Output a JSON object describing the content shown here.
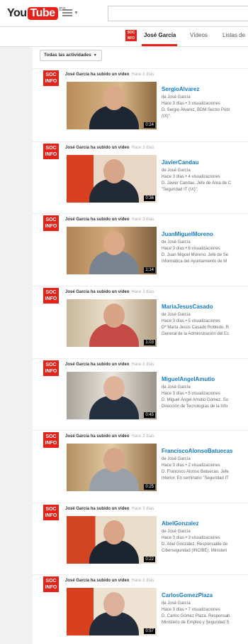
{
  "header": {
    "logo_you": "You",
    "logo_tube": "Tube",
    "logo_region": "ES"
  },
  "channel": {
    "avatar_text": "SOC NFO",
    "tabs": [
      "José García",
      "Vídeos",
      "Listas de"
    ]
  },
  "filter": {
    "label": "Todas las actividades"
  },
  "activity_label": "José García ha subido un vídeo",
  "ago_label": "Hace 3 días",
  "avatar_text": "SOC INFO",
  "items": [
    {
      "title": "SergioAlvarez",
      "by": "de José García",
      "meta": "Hace 3 días • 3 visualizaciones",
      "desc1": "D. Sergio Álvarez, BDM Sector Públ",
      "desc2": "(IX)\".",
      "duration": "0:24"
    },
    {
      "title": "JavierCandau",
      "by": "de José García",
      "meta": "Hace 3 días • 4 visualizaciones",
      "desc1": "D. Javier Candau. Jefe de Área de C",
      "desc2": "\"Seguridad IT (IX)\".",
      "duration": "0:36"
    },
    {
      "title": "JuanMiguelMoreno",
      "by": "de José García",
      "meta": "Hace 3 días • 6 visualizaciones",
      "desc1": "D. Juan Miguel Moreno. Jefe de Se",
      "desc2": "Informática del Ayuntamiento de M",
      "duration": "1:14"
    },
    {
      "title": "MariaJesusCasado",
      "by": "de José García",
      "meta": "Hace 3 días • 5 visualizaciones",
      "desc1": "Dª María Jesús Casado Robledo. R",
      "desc2": "General de la Administración del Es",
      "duration": "1:03"
    },
    {
      "title": "MiguelAngelAmutio",
      "by": "de José García",
      "meta": "Hace 3 días • 5 visualizaciones",
      "desc1": "D. Miguel Ángel Amutio Gómez. Su",
      "desc2": "Dirección de Tecnologías de la Info",
      "duration": "0:45"
    },
    {
      "title": "FranciscoAlonsoBatuecas",
      "by": "de José García",
      "meta": "Hace 3 días • 2 visualizaciones",
      "desc1": "D. Francisco Alonso Batuecas. Jefe",
      "desc2": "Interior. En seminario \"Seguridad IT",
      "duration": "0:25"
    },
    {
      "title": "AbelGonzalez",
      "by": "de José García",
      "meta": "Hace 3 días • 3 visualizaciones",
      "desc1": "D. Abel González. Responsable de ",
      "desc2": "Ciberseguridad (INCIBE). Ministeri",
      "duration": "0:22"
    },
    {
      "title": "CarlosGomezPlaza",
      "by": "de José García",
      "meta": "Hace 3 días • 7 visualizaciones",
      "desc1": "D. Carlos Gómez Plaza. Responsab",
      "desc2": "Ministerio de Empleo y Seguridad S",
      "duration": "0:57"
    }
  ],
  "colors": {
    "accent": "#e62117",
    "link": "#167ac6"
  }
}
